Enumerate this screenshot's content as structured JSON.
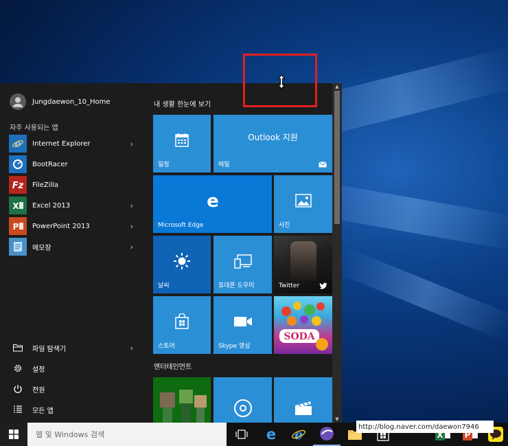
{
  "user": {
    "name": "Jungdaewon_10_Home"
  },
  "frequent_label": "자주 사용되는 앱",
  "apps": [
    {
      "label": "Internet Explorer",
      "icon": "internet-explorer-icon",
      "has_submenu": true
    },
    {
      "label": "BootRacer",
      "icon": "bootracer-icon",
      "has_submenu": false
    },
    {
      "label": "FileZilla",
      "icon": "filezilla-icon",
      "has_submenu": false
    },
    {
      "label": "Excel 2013",
      "icon": "excel-icon",
      "has_submenu": true
    },
    {
      "label": "PowerPoint 2013",
      "icon": "powerpoint-icon",
      "has_submenu": true
    },
    {
      "label": "메모장",
      "icon": "notepad-icon",
      "has_submenu": true
    }
  ],
  "bottom": [
    {
      "label": "파일 탐색기",
      "icon": "file-explorer-icon",
      "has_submenu": true
    },
    {
      "label": "설정",
      "icon": "settings-gear-icon",
      "has_submenu": false
    },
    {
      "label": "전원",
      "icon": "power-icon",
      "has_submenu": false
    },
    {
      "label": "모든 앱",
      "icon": "all-apps-icon",
      "has_submenu": false
    }
  ],
  "groups": {
    "life": "내 생활 한눈에 보기",
    "play": "엔터테인먼트"
  },
  "tiles": {
    "calendar": "일정",
    "mail_title": "Outlook 지원",
    "mail": "메일",
    "edge": "Microsoft Edge",
    "photos": "사진",
    "weather": "날씨",
    "phone": "휴대폰 도우미",
    "twitter": "Twitter",
    "store": "스토어",
    "skype": "Skype 영상"
  },
  "taskbar": {
    "search_placeholder": "웹 및 Windows 검색"
  },
  "watermark_url": "http://blog.naver.com/daewon7946",
  "colors": {
    "tile_blue": "#2b8fd6",
    "edge_blue": "#0a78d7",
    "menu_bg": "#1c1c1c",
    "highlight_red": "#e02020"
  }
}
